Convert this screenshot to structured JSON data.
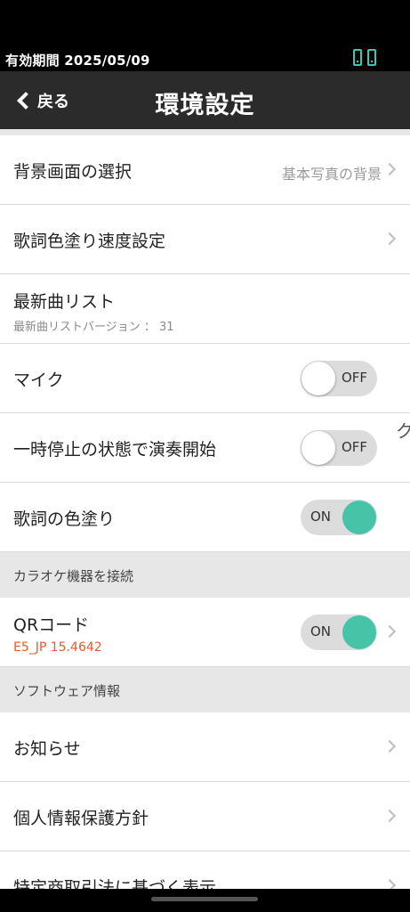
{
  "status_bar": {
    "text": "有効期間  2025/05/09",
    "icons": [
      "phone-icon",
      "phone-icon"
    ],
    "icon_color": "#3ec6b4"
  },
  "nav": {
    "back_label": "戻る",
    "title": "環境設定"
  },
  "rows": {
    "background": {
      "label": "背景画面の選択",
      "value": "基本写真の背景"
    },
    "lyrics_speed": {
      "label": "歌詞色塗り速度設定"
    },
    "newest_list": {
      "label": "最新曲リスト",
      "sub": "最新曲リストバージョン ： 31"
    },
    "mic": {
      "label": "マイク",
      "toggle": "OFF"
    },
    "pause_start": {
      "label": "一時停止の状態で演奏開始",
      "toggle": "OFF"
    },
    "lyrics_color": {
      "label": "歌詞の色塗り",
      "toggle": "ON"
    }
  },
  "section_karaoke": {
    "header": "カラオケ機器を接続",
    "qr": {
      "label": "QRコード",
      "sub": "E5_JP 15.4642",
      "toggle": "ON"
    }
  },
  "section_software": {
    "header": "ソフトウェア情報",
    "items": [
      "お知らせ",
      "個人情報保護方針",
      "特定商取引法に基づく表示"
    ]
  },
  "colors": {
    "accent": "#47c3a8",
    "nav_bg": "#2b2b2b",
    "sub_accent": "#e35d2b"
  },
  "edge_glyph": "ク"
}
